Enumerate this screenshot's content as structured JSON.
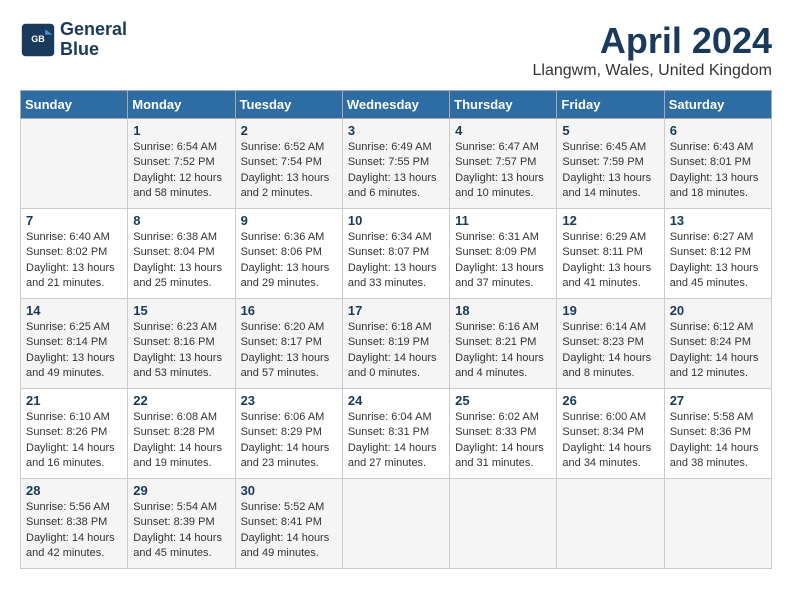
{
  "logo": {
    "line1": "General",
    "line2": "Blue"
  },
  "title": "April 2024",
  "subtitle": "Llangwm, Wales, United Kingdom",
  "days_of_week": [
    "Sunday",
    "Monday",
    "Tuesday",
    "Wednesday",
    "Thursday",
    "Friday",
    "Saturday"
  ],
  "weeks": [
    [
      {
        "day": "",
        "info": ""
      },
      {
        "day": "1",
        "info": "Sunrise: 6:54 AM\nSunset: 7:52 PM\nDaylight: 12 hours\nand 58 minutes."
      },
      {
        "day": "2",
        "info": "Sunrise: 6:52 AM\nSunset: 7:54 PM\nDaylight: 13 hours\nand 2 minutes."
      },
      {
        "day": "3",
        "info": "Sunrise: 6:49 AM\nSunset: 7:55 PM\nDaylight: 13 hours\nand 6 minutes."
      },
      {
        "day": "4",
        "info": "Sunrise: 6:47 AM\nSunset: 7:57 PM\nDaylight: 13 hours\nand 10 minutes."
      },
      {
        "day": "5",
        "info": "Sunrise: 6:45 AM\nSunset: 7:59 PM\nDaylight: 13 hours\nand 14 minutes."
      },
      {
        "day": "6",
        "info": "Sunrise: 6:43 AM\nSunset: 8:01 PM\nDaylight: 13 hours\nand 18 minutes."
      }
    ],
    [
      {
        "day": "7",
        "info": "Sunrise: 6:40 AM\nSunset: 8:02 PM\nDaylight: 13 hours\nand 21 minutes."
      },
      {
        "day": "8",
        "info": "Sunrise: 6:38 AM\nSunset: 8:04 PM\nDaylight: 13 hours\nand 25 minutes."
      },
      {
        "day": "9",
        "info": "Sunrise: 6:36 AM\nSunset: 8:06 PM\nDaylight: 13 hours\nand 29 minutes."
      },
      {
        "day": "10",
        "info": "Sunrise: 6:34 AM\nSunset: 8:07 PM\nDaylight: 13 hours\nand 33 minutes."
      },
      {
        "day": "11",
        "info": "Sunrise: 6:31 AM\nSunset: 8:09 PM\nDaylight: 13 hours\nand 37 minutes."
      },
      {
        "day": "12",
        "info": "Sunrise: 6:29 AM\nSunset: 8:11 PM\nDaylight: 13 hours\nand 41 minutes."
      },
      {
        "day": "13",
        "info": "Sunrise: 6:27 AM\nSunset: 8:12 PM\nDaylight: 13 hours\nand 45 minutes."
      }
    ],
    [
      {
        "day": "14",
        "info": "Sunrise: 6:25 AM\nSunset: 8:14 PM\nDaylight: 13 hours\nand 49 minutes."
      },
      {
        "day": "15",
        "info": "Sunrise: 6:23 AM\nSunset: 8:16 PM\nDaylight: 13 hours\nand 53 minutes."
      },
      {
        "day": "16",
        "info": "Sunrise: 6:20 AM\nSunset: 8:17 PM\nDaylight: 13 hours\nand 57 minutes."
      },
      {
        "day": "17",
        "info": "Sunrise: 6:18 AM\nSunset: 8:19 PM\nDaylight: 14 hours\nand 0 minutes."
      },
      {
        "day": "18",
        "info": "Sunrise: 6:16 AM\nSunset: 8:21 PM\nDaylight: 14 hours\nand 4 minutes."
      },
      {
        "day": "19",
        "info": "Sunrise: 6:14 AM\nSunset: 8:23 PM\nDaylight: 14 hours\nand 8 minutes."
      },
      {
        "day": "20",
        "info": "Sunrise: 6:12 AM\nSunset: 8:24 PM\nDaylight: 14 hours\nand 12 minutes."
      }
    ],
    [
      {
        "day": "21",
        "info": "Sunrise: 6:10 AM\nSunset: 8:26 PM\nDaylight: 14 hours\nand 16 minutes."
      },
      {
        "day": "22",
        "info": "Sunrise: 6:08 AM\nSunset: 8:28 PM\nDaylight: 14 hours\nand 19 minutes."
      },
      {
        "day": "23",
        "info": "Sunrise: 6:06 AM\nSunset: 8:29 PM\nDaylight: 14 hours\nand 23 minutes."
      },
      {
        "day": "24",
        "info": "Sunrise: 6:04 AM\nSunset: 8:31 PM\nDaylight: 14 hours\nand 27 minutes."
      },
      {
        "day": "25",
        "info": "Sunrise: 6:02 AM\nSunset: 8:33 PM\nDaylight: 14 hours\nand 31 minutes."
      },
      {
        "day": "26",
        "info": "Sunrise: 6:00 AM\nSunset: 8:34 PM\nDaylight: 14 hours\nand 34 minutes."
      },
      {
        "day": "27",
        "info": "Sunrise: 5:58 AM\nSunset: 8:36 PM\nDaylight: 14 hours\nand 38 minutes."
      }
    ],
    [
      {
        "day": "28",
        "info": "Sunrise: 5:56 AM\nSunset: 8:38 PM\nDaylight: 14 hours\nand 42 minutes."
      },
      {
        "day": "29",
        "info": "Sunrise: 5:54 AM\nSunset: 8:39 PM\nDaylight: 14 hours\nand 45 minutes."
      },
      {
        "day": "30",
        "info": "Sunrise: 5:52 AM\nSunset: 8:41 PM\nDaylight: 14 hours\nand 49 minutes."
      },
      {
        "day": "",
        "info": ""
      },
      {
        "day": "",
        "info": ""
      },
      {
        "day": "",
        "info": ""
      },
      {
        "day": "",
        "info": ""
      }
    ]
  ]
}
